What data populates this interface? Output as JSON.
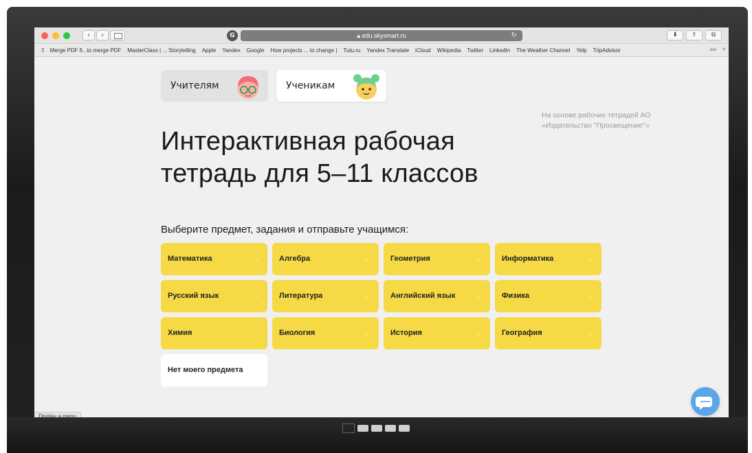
{
  "browser": {
    "url": "edu.skysmart.ru",
    "extension_label": "G",
    "bookmarks": [
      "Merge PDF fi...to merge PDF",
      "MasterClass | ... Storytelling",
      "Apple",
      "Yandex",
      "Google",
      "How projects ... to change |",
      "Tutu.ru",
      "Yandex Translate",
      "iCloud",
      "Wikipedia",
      "Twitter",
      "LinkedIn",
      "The Weather Channel",
      "Yelp",
      "TripAdvisor"
    ],
    "bookmarks_more": ">>",
    "status_text": "Display a menu"
  },
  "roles": {
    "teacher_label": "Учителям",
    "student_label": "Ученикам",
    "active": "student"
  },
  "source_note": "На основе рабочих тетрадей АО «Издательство \"Просвещение\"»",
  "headline": {
    "line1": "Интерактивная рабочая",
    "line2": "тетрадь для 5–11 классов"
  },
  "subtitle": "Выберите предмет, задания и отправьте учащимся:",
  "subjects": [
    "Математика",
    "Алгебра",
    "Геометрия",
    "Информатика",
    "Русский язык",
    "Литература",
    "Английский язык",
    "Физика",
    "Химия",
    "Биология",
    "История",
    "География"
  ],
  "other_subject": "Нет моего предмета",
  "arrow_glyph": "→",
  "colors": {
    "subject_bg": "#f5d945",
    "page_bg": "#f0f0f0",
    "chat_button": "#5aa6e8"
  }
}
